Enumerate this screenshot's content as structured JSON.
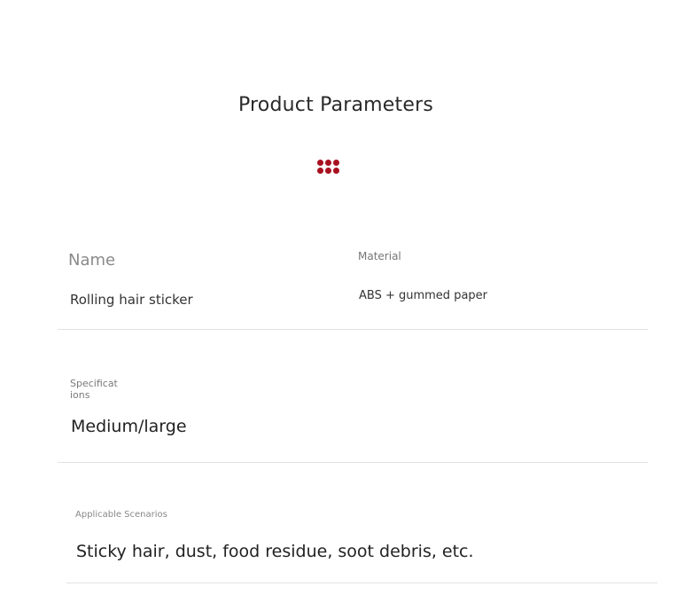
{
  "title": "Product Parameters",
  "accent_color": "#a8111f",
  "params": {
    "name": {
      "label": "Name",
      "value": "Rolling hair sticker"
    },
    "material": {
      "label": "Material",
      "value": "ABS + gummed paper"
    },
    "specifications": {
      "label_line1": "Specificat",
      "label_line2": "ions",
      "value": "Medium/large"
    },
    "scenarios": {
      "label": "Applicable Scenarios",
      "value": "Sticky hair, dust, food residue, soot debris, etc."
    }
  }
}
